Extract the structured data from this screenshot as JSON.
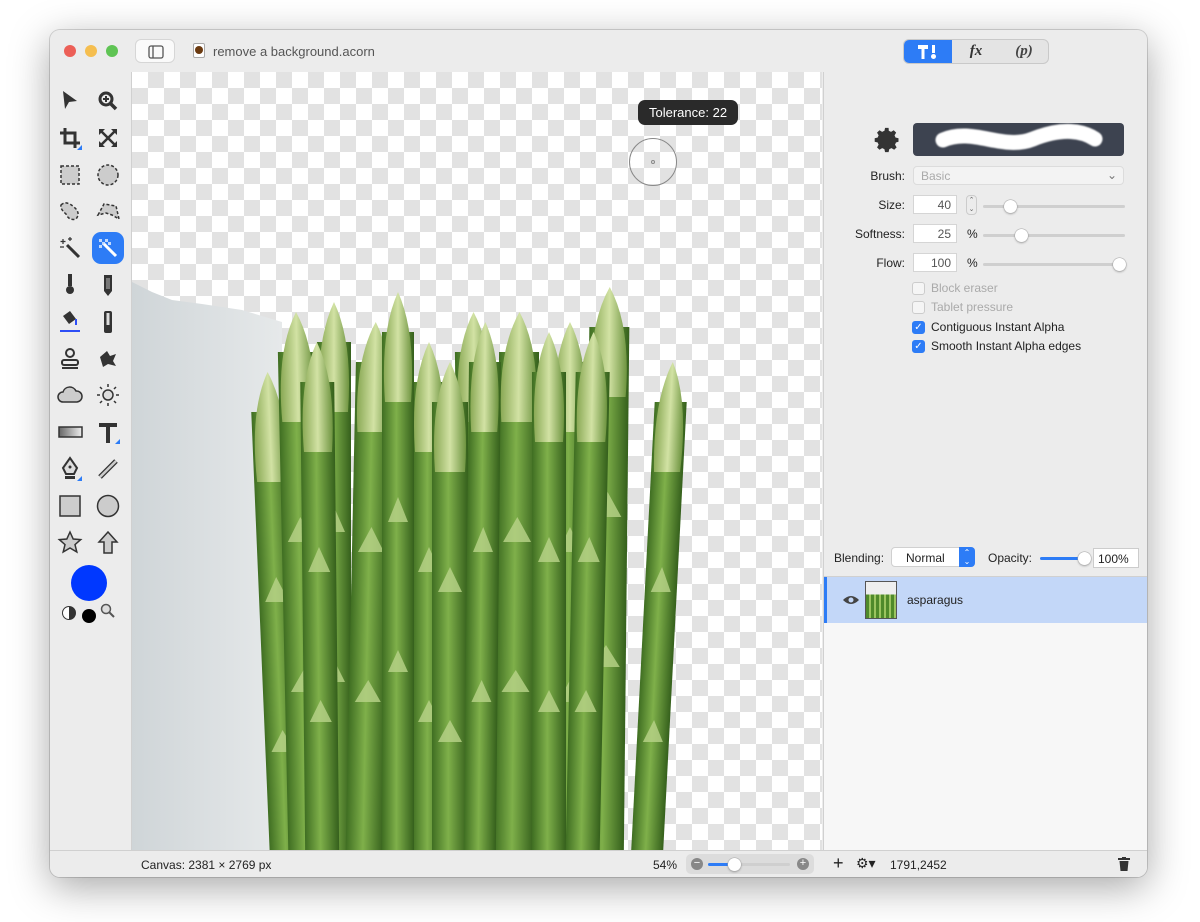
{
  "window": {
    "title": "remove a background.acorn",
    "traffic_colors": [
      "#ec5f57",
      "#f5be4f",
      "#5fc454"
    ]
  },
  "header": {
    "tabs": [
      {
        "name": "tools-tab",
        "label": "",
        "active": true
      },
      {
        "name": "effects-tab",
        "label": "fx"
      },
      {
        "name": "python-tab",
        "label": "(p)"
      }
    ]
  },
  "toolbar": {
    "tools": [
      "select-arrow",
      "zoom",
      "crop",
      "transform",
      "rect-select",
      "ellipse-select",
      "lasso",
      "polygon-lasso",
      "magic-wand",
      "instant-alpha",
      "brush",
      "pencil",
      "paint-bucket",
      "eraser",
      "clone-stamp",
      "smudge",
      "cloud-blur",
      "sun-burn",
      "gradient",
      "text",
      "pen",
      "line",
      "rectangle",
      "circle",
      "star",
      "arrow"
    ],
    "selected": "instant-alpha",
    "foreground_color": "#0038ff",
    "background_color": "#000000"
  },
  "canvas": {
    "tooltip": "Tolerance: 22"
  },
  "brush_panel": {
    "brush_label": "Brush:",
    "brush_value": "Basic",
    "size_label": "Size:",
    "size_value": "40",
    "softness_label": "Softness:",
    "softness_value": "25",
    "softness_unit": "%",
    "flow_label": "Flow:",
    "flow_value": "100",
    "flow_unit": "%",
    "size_slider": 0.2,
    "softness_slider": 0.25,
    "flow_slider": 1.0,
    "checkboxes": [
      {
        "label": "Block eraser",
        "checked": false,
        "enabled": false
      },
      {
        "label": "Tablet pressure",
        "checked": false,
        "enabled": false
      },
      {
        "label": "Contiguous Instant Alpha",
        "checked": true,
        "enabled": true
      },
      {
        "label": "Smooth Instant Alpha edges",
        "checked": true,
        "enabled": true
      }
    ]
  },
  "layers": {
    "blending_label": "Blending:",
    "blending_value": "Normal",
    "opacity_label": "Opacity:",
    "opacity_value": "100%",
    "opacity_slider": 1.0,
    "items": [
      {
        "name": "asparagus",
        "visible": true,
        "selected": true
      }
    ]
  },
  "status": {
    "canvas_size": "Canvas: 2381 × 2769 px",
    "zoom": "54%",
    "zoom_slider": 0.25,
    "coords": "1791,2452"
  }
}
